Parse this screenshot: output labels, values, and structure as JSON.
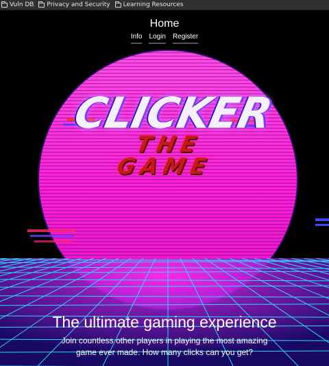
{
  "bookmarks": [
    {
      "label": "Vuln DB"
    },
    {
      "label": "Privacy and Security"
    },
    {
      "label": "Learning Resources"
    }
  ],
  "nav": {
    "title": "Home",
    "links": [
      {
        "label": "Info"
      },
      {
        "label": "Login"
      },
      {
        "label": "Register"
      }
    ]
  },
  "hero": {
    "logo_line1": "CLICKER",
    "logo_line2": "THE GAME",
    "tagline": "The ultimate gaming experience",
    "subtext": "Join countless other players in playing the most amazing game ever made. How many clicks can you get?"
  },
  "colors": {
    "sun": "#ff1fd6",
    "grid": "#2fd6ff",
    "logo_top": "#f4f0ff",
    "logo_bottom": "#c91818",
    "background": "#000000"
  }
}
